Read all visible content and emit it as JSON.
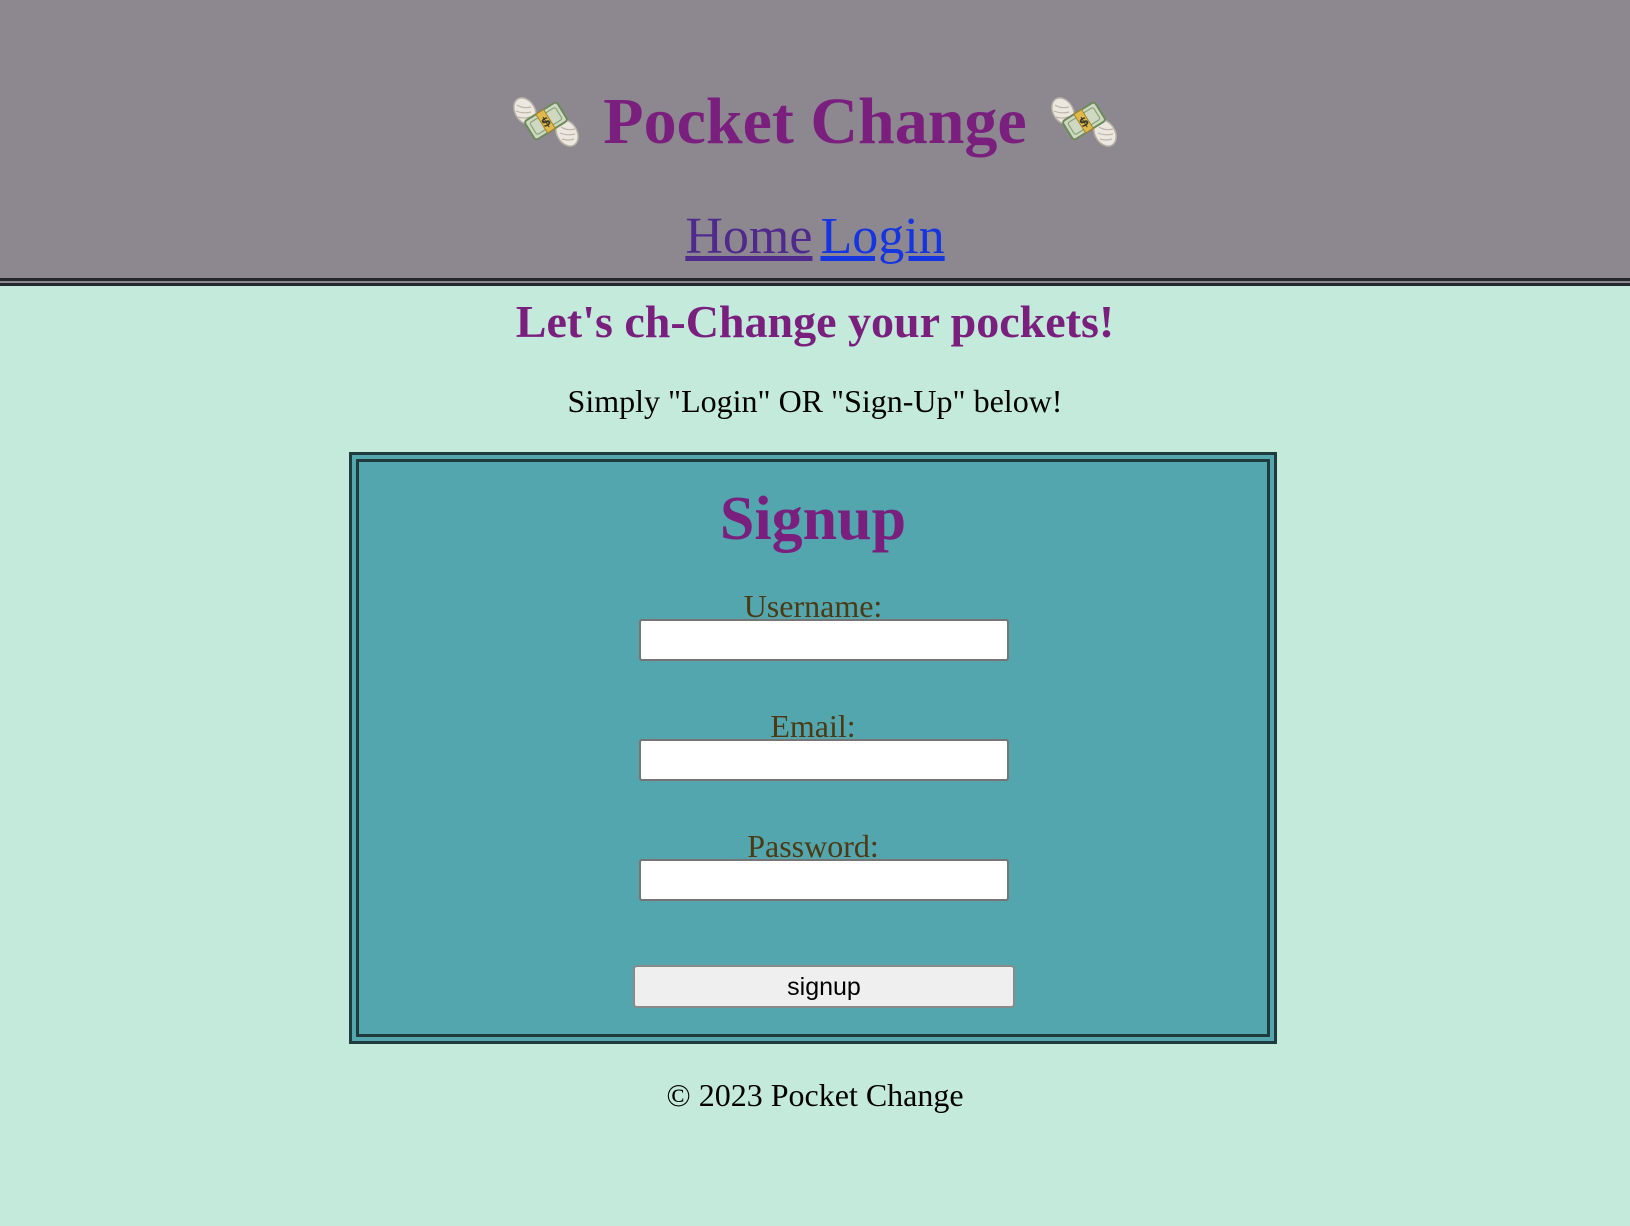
{
  "header": {
    "title": "Pocket Change",
    "left_icon": "money-with-wings-icon",
    "right_icon": "money-with-wings-icon",
    "nav": {
      "home_label": "Home",
      "login_label": "Login"
    }
  },
  "main": {
    "tagline": "Let's ch-Change your pockets!",
    "instructions": "Simply \"Login\" OR \"Sign-Up\" below!",
    "signup_form": {
      "title": "Signup",
      "fields": [
        {
          "label": "Username:",
          "value": ""
        },
        {
          "label": "Email:",
          "value": ""
        },
        {
          "label": "Password:",
          "value": ""
        }
      ],
      "submit_label": "signup"
    }
  },
  "footer": {
    "text": "© 2023 Pocket Change"
  },
  "colors": {
    "header_bg": "#8d8890",
    "page_bg": "#c3eadb",
    "card_bg": "#53a6ad",
    "brand_purple": "#7a1f7e",
    "label_brown": "#4b3a14",
    "link_visited": "#4f2a8c",
    "link_blue": "#1535e0"
  }
}
